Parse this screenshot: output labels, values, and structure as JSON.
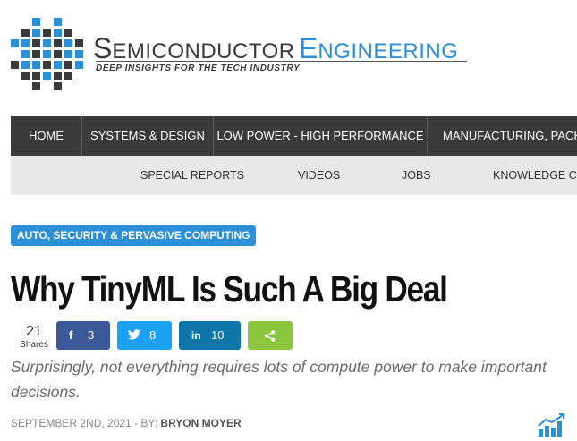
{
  "logo": {
    "title_part1_initial": "S",
    "title_part1_rest": "EMICONDUCTOR",
    "title_part2_initial": "E",
    "title_part2_rest": "NGINEERING",
    "tagline": "DEEP INSIGHTS FOR THE TECH INDUSTRY",
    "colors": {
      "dark": "#3a3a3a",
      "blue": "#2d8fd6"
    }
  },
  "primary_nav": {
    "items": [
      {
        "label": "HOME"
      },
      {
        "label": "SYSTEMS & DESIGN"
      },
      {
        "label": "LOW POWER - HIGH PERFORMANCE"
      },
      {
        "label": "MANUFACTURING, PACKAG"
      }
    ]
  },
  "secondary_nav": {
    "items": [
      {
        "label": "SPECIAL REPORTS"
      },
      {
        "label": "VIDEOS"
      },
      {
        "label": "JOBS"
      },
      {
        "label": "KNOWLEDGE CE"
      }
    ]
  },
  "article": {
    "category": "AUTO, SECURITY & PERVASIVE COMPUTING",
    "title": "Why TinyML Is Such A Big Deal",
    "excerpt": "Surprisingly, not everything requires lots of compute power to make important decisions.",
    "date": "SEPTEMBER 2ND, 2021",
    "by_label": " - BY: ",
    "author": "BRYON MOYER"
  },
  "share": {
    "total": "21",
    "total_label": "Shares",
    "buttons": [
      {
        "network": "facebook",
        "icon": "facebook-icon",
        "glyph": "f",
        "count": "3",
        "color": "#3b5998"
      },
      {
        "network": "twitter",
        "icon": "twitter-icon",
        "glyph": "🐦",
        "count": "8",
        "color": "#1da1f2"
      },
      {
        "network": "linkedin",
        "icon": "linkedin-icon",
        "glyph": "in",
        "count": "10",
        "color": "#0e76a8"
      },
      {
        "network": "share",
        "icon": "share-icon",
        "glyph": "",
        "count": "",
        "color": "#8cc63f"
      }
    ]
  }
}
